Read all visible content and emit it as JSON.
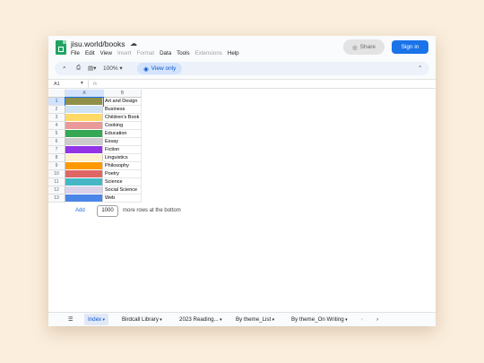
{
  "app": {
    "title": "jisu.world/books",
    "menu": [
      "File",
      "Edit",
      "View",
      "Insert",
      "Format",
      "Data",
      "Tools",
      "Extensions",
      "Help"
    ],
    "menu_disabled": [
      "Insert",
      "Format",
      "Extensions"
    ],
    "share_label": "Share",
    "signin_label": "Sign in"
  },
  "toolbar": {
    "zoom": "100%",
    "view_only_label": "View only"
  },
  "formula_bar": {
    "cell_ref": "A1",
    "fx_label": "fx"
  },
  "sheet": {
    "columns": [
      "A",
      "B"
    ],
    "rows": [
      {
        "num": "1",
        "label": "Art and Design",
        "color": "#8f8f4a"
      },
      {
        "num": "2",
        "label": "Business",
        "color": "#cfe2f3"
      },
      {
        "num": "3",
        "label": "Children's Book",
        "color": "#ffd966"
      },
      {
        "num": "4",
        "label": "Cooking",
        "color": "#ea9999"
      },
      {
        "num": "5",
        "label": "Education",
        "color": "#34a853"
      },
      {
        "num": "6",
        "label": "Essay",
        "color": "#cccccc"
      },
      {
        "num": "7",
        "label": "Fiction",
        "color": "#9334e6"
      },
      {
        "num": "8",
        "label": "Linguistics",
        "color": "#fff2cc"
      },
      {
        "num": "9",
        "label": "Philosophy",
        "color": "#ff9900"
      },
      {
        "num": "10",
        "label": "Poetry",
        "color": "#e06666"
      },
      {
        "num": "11",
        "label": "Science",
        "color": "#45b7c4"
      },
      {
        "num": "12",
        "label": "Social Science",
        "color": "#d9d2e9"
      },
      {
        "num": "13",
        "label": "Web",
        "color": "#4a86e8"
      }
    ],
    "add_label": "Add",
    "add_count": "1000",
    "add_suffix": "more rows at the bottom"
  },
  "tabs": [
    {
      "label": "Index",
      "active": true
    },
    {
      "label": "Birdcall Library",
      "active": false
    },
    {
      "label": "2023 Reading...",
      "active": false
    },
    {
      "label": "By theme_List",
      "active": false
    },
    {
      "label": "By theme_On Writing",
      "active": false
    }
  ]
}
